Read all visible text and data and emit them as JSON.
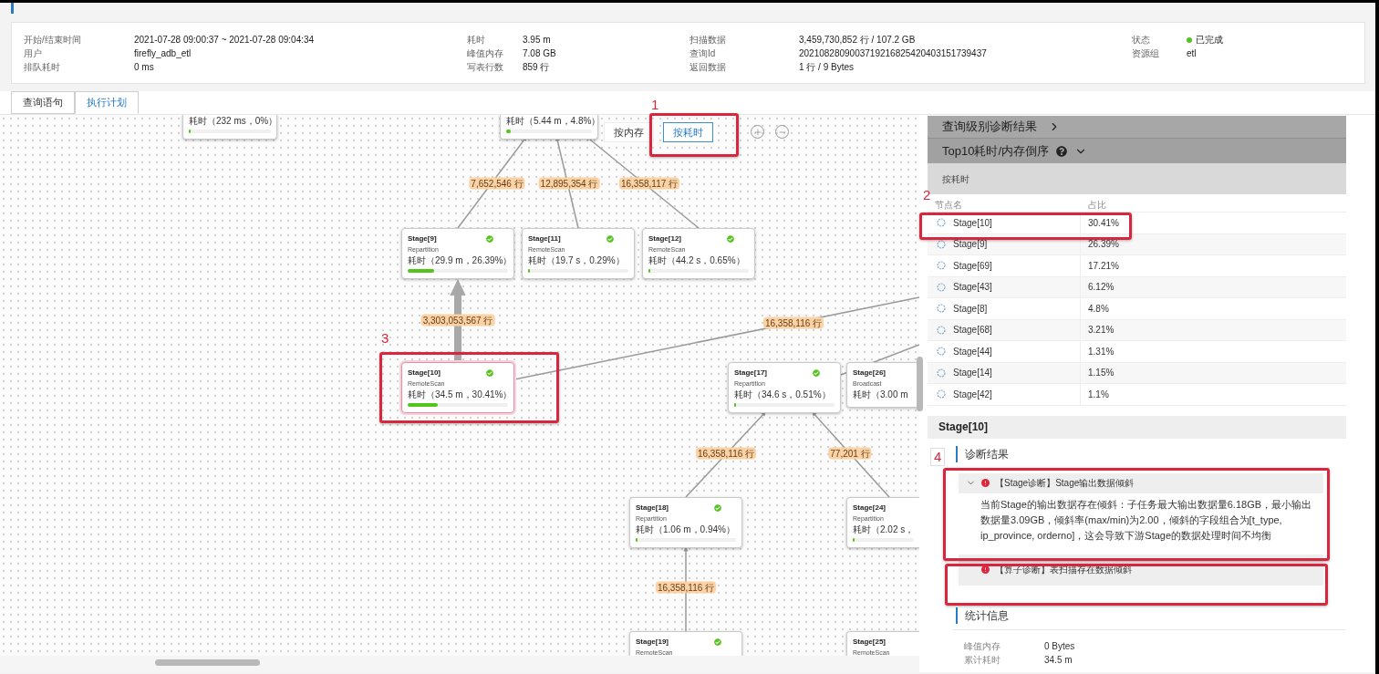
{
  "attributes": [
    [
      {
        "label": "开始/结束时间",
        "value": "2021-07-28 09:00:37 ~ 2021-07-28 09:04:34",
        "kind": "text"
      },
      {
        "label": "用户",
        "value": "firefly_adb_etl",
        "kind": "text"
      },
      {
        "label": "排队耗时",
        "value": "0 ms",
        "kind": "text"
      }
    ],
    [
      {
        "label": "耗时",
        "value": "3.95 m",
        "kind": "text"
      },
      {
        "label": "峰值内存",
        "value": "7.08 GB",
        "kind": "text"
      },
      {
        "label": "写表行数",
        "value": "859 行",
        "kind": "text"
      }
    ],
    [
      {
        "label": "扫描数据",
        "value": "3,459,730,852 行 / 107.2 GB",
        "kind": "text"
      },
      {
        "label": "查询Id",
        "value": "2021082809003719216825420403151739437",
        "kind": "text"
      },
      {
        "label": "返回数据",
        "value": "1 行 / 9 Bytes",
        "kind": "text"
      }
    ],
    [
      {
        "label": "状态",
        "value": "已完成",
        "kind": "status"
      },
      {
        "label": "资源组",
        "value": "etl",
        "kind": "text"
      }
    ]
  ],
  "tabs": [
    {
      "label": "查询语句",
      "selected": false
    },
    {
      "label": "执行计划",
      "selected": true
    }
  ],
  "plan": {
    "sort_buttons": [
      {
        "label": "按内存",
        "selected": false
      },
      {
        "label": "按耗时",
        "selected": true
      }
    ],
    "nodes": [
      {
        "kind": "partial",
        "time": "耗时（232 ms，0%）",
        "level": 0,
        "highlighted": false
      },
      {
        "kind": "partial",
        "time": "耗时（5.44 m，4.8%）",
        "level": 0.048,
        "highlighted": false
      },
      {
        "kind": "stage",
        "title": "Stage[9]",
        "operator": "Repartition",
        "time": "耗时（29.9 m，26.39%）",
        "level": 0.2639,
        "completed": true,
        "highlighted": false
      },
      {
        "kind": "stage",
        "title": "Stage[11]",
        "operator": "RemoteScan",
        "time": "耗时（19.7 s，0.29%）",
        "level": 0.0029,
        "completed": true,
        "highlighted": false
      },
      {
        "kind": "stage",
        "title": "Stage[12]",
        "operator": "RemoteScan",
        "time": "耗时（44.2 s，0.65%）",
        "level": 0.0065,
        "completed": true,
        "highlighted": false
      },
      {
        "kind": "stage",
        "title": "Stage[10]",
        "operator": "RemoteScan",
        "time": "耗时（34.5 m，30.41%）",
        "level": 0.3041,
        "completed": true,
        "highlighted": true
      },
      {
        "kind": "stage",
        "title": "Stage[17]",
        "operator": "Repartition",
        "time": "耗时（34.6 s，0.51%）",
        "level": 0.0051,
        "completed": true,
        "highlighted": false
      },
      {
        "kind": "stage",
        "title": "Stage[26]",
        "operator": "Broadcast",
        "time": "耗时（3.00 m",
        "highlighted": false
      },
      {
        "kind": "stage",
        "title": "Stage[18]",
        "operator": "Repartition",
        "time": "耗时（1.06 m，0.94%）",
        "level": 0.0094,
        "completed": true,
        "highlighted": false
      },
      {
        "kind": "stage",
        "title": "Stage[24]",
        "operator": "Repartition",
        "time": "耗时（2.02 s，",
        "level": 0.004,
        "highlighted": false
      },
      {
        "kind": "stage",
        "title": "Stage[19]",
        "operator": "RemoteScan",
        "completed": true,
        "highlighted": false
      },
      {
        "kind": "stage",
        "title": "Stage[25]",
        "operator": "RemoteScan",
        "highlighted": false
      }
    ],
    "edges": [
      {
        "rows": "7,652,546 行",
        "highlighted": false
      },
      {
        "rows": "12,895,354 行",
        "highlighted": false
      },
      {
        "rows": "16,358,117 行",
        "highlighted": false
      },
      {
        "rows": "3,303,053,567 行",
        "highlighted": true
      },
      {
        "rows": "16,358,116 行",
        "highlighted": false
      },
      {
        "rows": "16,358,116 行",
        "highlighted": false
      },
      {
        "rows": "77,201 行",
        "highlighted": false
      },
      {
        "rows": "16,358,116 行",
        "highlighted": false
      }
    ]
  },
  "diagnosis": {
    "query_level": "查询级别诊断结果",
    "top10": {
      "title": "Top10耗时/内存倒序",
      "expanded": true,
      "sort_label": "按耗时",
      "columns": [
        "节点名",
        "占比"
      ],
      "rows": [
        {
          "node": "Stage[10]",
          "share": "30.41%"
        },
        {
          "node": "Stage[9]",
          "share": "26.39%"
        },
        {
          "node": "Stage[69]",
          "share": "17.21%"
        },
        {
          "node": "Stage[43]",
          "share": "6.12%"
        },
        {
          "node": "Stage[8]",
          "share": "4.8%"
        },
        {
          "node": "Stage[68]",
          "share": "3.21%"
        },
        {
          "node": "Stage[44]",
          "share": "1.31%"
        },
        {
          "node": "Stage[14]",
          "share": "1.15%"
        },
        {
          "node": "Stage[42]",
          "share": "1.1%"
        }
      ]
    },
    "stage": {
      "title": "Stage[10]",
      "diagnosis_heading": "诊断结果",
      "items": [
        {
          "title": "【Stage诊断】Stage输出数据倾斜",
          "expanded": true,
          "detail": "当前Stage的输出数据存在倾斜：子任务最大输出数据量6.18GB，最小输出数据量3.09GB，倾斜率(max/min)为2.00，倾斜的字段组合为[t_type, ip_province, orderno]，这会导致下游Stage的数据处理时间不均衡"
        },
        {
          "title": "【算子诊断】表扫描存在数据倾斜",
          "expanded": false
        }
      ],
      "stats_heading": "统计信息",
      "stats": [
        {
          "label": "峰值内存",
          "value": "0 Bytes"
        },
        {
          "label": "累计耗时",
          "value": "34.5 m"
        }
      ]
    }
  },
  "annotations": [
    {
      "kind": "box",
      "number": "1"
    },
    {
      "kind": "box",
      "number": "2"
    },
    {
      "kind": "box",
      "number": "3"
    },
    {
      "kind": "tag",
      "number": "4"
    },
    {
      "kind": "frame"
    },
    {
      "kind": "frame"
    }
  ]
}
